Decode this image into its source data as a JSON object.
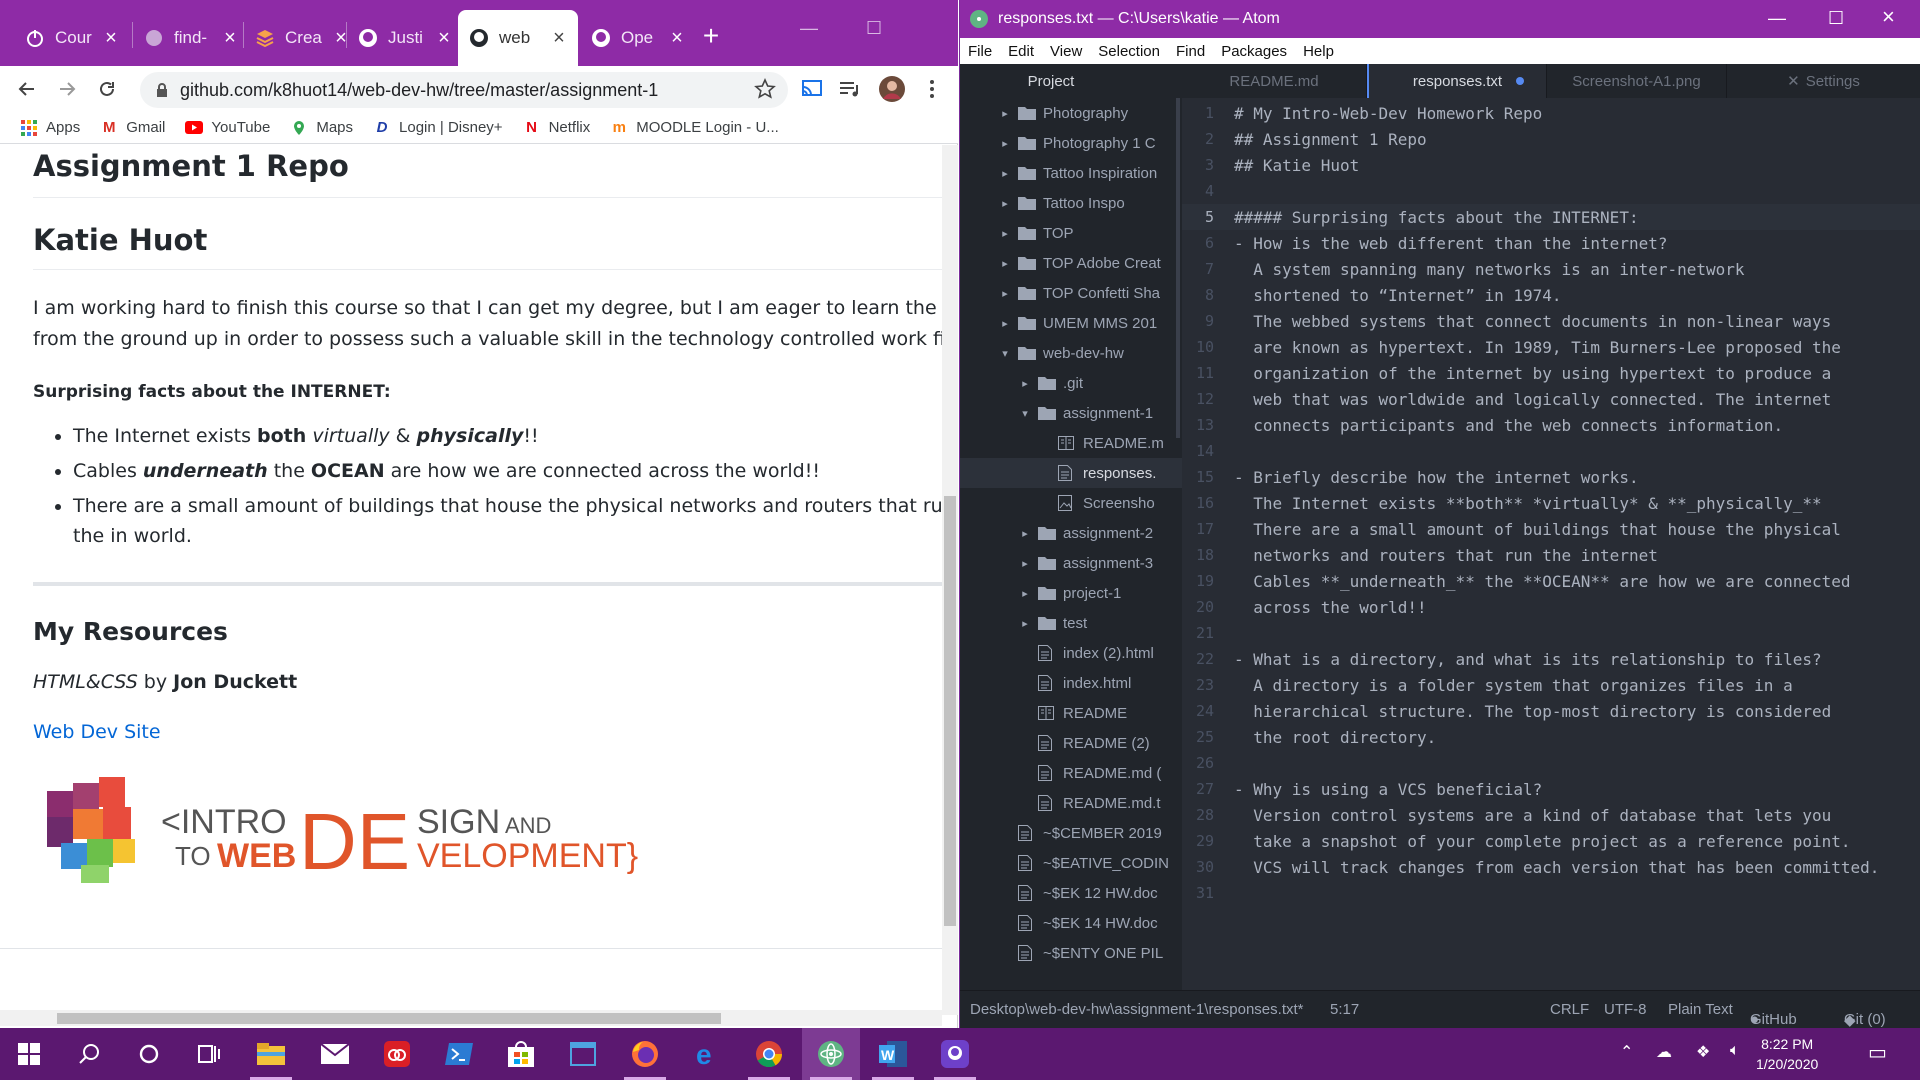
{
  "chrome": {
    "tabs": [
      {
        "label": "Cour",
        "icon": "power-icon"
      },
      {
        "label": "find-",
        "icon": "globe-icon"
      },
      {
        "label": "Crea",
        "icon": "layers-icon"
      },
      {
        "label": "Justi",
        "icon": "github-icon"
      },
      {
        "label": "web",
        "icon": "github-icon"
      },
      {
        "label": "Ope",
        "icon": "github-icon"
      }
    ],
    "new_tab_label": "+",
    "url": "github.com/k8huot14/web-dev-hw/tree/master/assignment-1",
    "bookmarks": [
      {
        "label": "Apps",
        "icon": "apps-grid-icon"
      },
      {
        "label": "Gmail",
        "icon": "gmail-icon"
      },
      {
        "label": "YouTube",
        "icon": "youtube-icon"
      },
      {
        "label": "Maps",
        "icon": "maps-icon"
      },
      {
        "label": "Login | Disney+",
        "icon": "disney-icon"
      },
      {
        "label": "Netflix",
        "icon": "netflix-icon"
      },
      {
        "label": "MOODLE Login - U...",
        "icon": "moodle-icon"
      }
    ]
  },
  "readme": {
    "h_assignment": "Assignment 1 Repo",
    "h_name": "Katie Huot",
    "intro_line1": "I am working hard to finish this course so that I can get my degree, but I am eager to learn the process",
    "intro_line2": "from the ground up in order to possess such a valuable skill in the technology controlled work field of t",
    "facts_heading": "Surprising facts about the INTERNET:",
    "fact1": {
      "a": "The Internet exists ",
      "b": "both",
      "c": " ",
      "d": "virtually",
      "e": " & ",
      "f": "physically",
      "g": "!!"
    },
    "fact2": {
      "a": "Cables ",
      "b": "underneath",
      "c": " the ",
      "d": "OCEAN",
      "e": " are how we are connected across the world!!"
    },
    "fact3": "There are a small amount of buildings that house the physical networks and routers that run the in world.",
    "resources_heading": "My Resources",
    "book_title": "HTML&CSS",
    "book_by": " by ",
    "book_author": "Jon Duckett",
    "link_label": "Web Dev Site",
    "logo": {
      "line1a": "<INTRO",
      "line1b": "TO WEB",
      "big": "DE",
      "sign": "SIGN AND",
      "velop": "VELOPMENT}"
    }
  },
  "atom": {
    "title": "responses.txt — C:\\Users\\katie — Atom",
    "menu": [
      "File",
      "Edit",
      "View",
      "Selection",
      "Find",
      "Packages",
      "Help"
    ],
    "project_label": "Project",
    "tabs": [
      "README.md",
      "responses.txt",
      "Screenshot-A1.png",
      "Settings"
    ],
    "tree": [
      {
        "label": "Photography",
        "type": "folder",
        "depth": 0,
        "open": false
      },
      {
        "label": "Photography 1 C",
        "type": "folder",
        "depth": 0,
        "open": false
      },
      {
        "label": "Tattoo Inspiration",
        "type": "folder",
        "depth": 0,
        "open": false
      },
      {
        "label": "Tattoo Inspo",
        "type": "folder",
        "depth": 0,
        "open": false
      },
      {
        "label": "TOP",
        "type": "folder",
        "depth": 0,
        "open": false
      },
      {
        "label": "TOP Adobe Creat",
        "type": "folder",
        "depth": 0,
        "open": false
      },
      {
        "label": "TOP Confetti Sha",
        "type": "folder",
        "depth": 0,
        "open": false
      },
      {
        "label": "UMEM MMS 201",
        "type": "folder",
        "depth": 0,
        "open": false
      },
      {
        "label": "web-dev-hw",
        "type": "folder",
        "depth": 0,
        "open": true
      },
      {
        "label": ".git",
        "type": "folder",
        "depth": 1,
        "open": false
      },
      {
        "label": "assignment-1",
        "type": "folder",
        "depth": 1,
        "open": true
      },
      {
        "label": "README.m",
        "type": "book",
        "depth": 2
      },
      {
        "label": "responses.",
        "type": "file",
        "depth": 2,
        "selected": true
      },
      {
        "label": "Screensho",
        "type": "image",
        "depth": 2
      },
      {
        "label": "assignment-2",
        "type": "folder",
        "depth": 1,
        "open": false
      },
      {
        "label": "assignment-3",
        "type": "folder",
        "depth": 1,
        "open": false
      },
      {
        "label": "project-1",
        "type": "folder",
        "depth": 1,
        "open": false
      },
      {
        "label": "test",
        "type": "folder",
        "depth": 1,
        "open": false
      },
      {
        "label": "index (2).html",
        "type": "file",
        "depth": 1
      },
      {
        "label": "index.html",
        "type": "file",
        "depth": 1
      },
      {
        "label": "README",
        "type": "book",
        "depth": 1
      },
      {
        "label": "README (2)",
        "type": "file",
        "depth": 1
      },
      {
        "label": "README.md (",
        "type": "file",
        "depth": 1
      },
      {
        "label": "README.md.t",
        "type": "file",
        "depth": 1
      },
      {
        "label": "~$CEMBER 2019",
        "type": "file",
        "depth": 0
      },
      {
        "label": "~$EATIVE_CODIN",
        "type": "file",
        "depth": 0
      },
      {
        "label": "~$EK 12 HW.doc",
        "type": "file",
        "depth": 0
      },
      {
        "label": "~$EK 14 HW.doc",
        "type": "file",
        "depth": 0
      },
      {
        "label": "~$ENTY ONE PIL",
        "type": "file",
        "depth": 0
      }
    ],
    "lines": [
      "# My Intro-Web-Dev Homework Repo",
      "## Assignment 1 Repo",
      "## Katie Huot",
      "",
      "##### Surprising facts about the INTERNET:",
      "- How is the web different than the internet?",
      "  A system spanning many networks is an inter-network",
      "  shortened to “Internet” in 1974.",
      "  The webbed systems that connect documents in non-linear ways",
      "  are known as hypertext. In 1989, Tim Burners-Lee proposed the",
      "  organization of the internet by using hypertext to produce a",
      "  web that was worldwide and logically connected. The internet",
      "  connects participants and the web connects information.",
      "",
      "- Briefly describe how the internet works.",
      "  The Internet exists **both** *virtually* & **_physically_**",
      "  There are a small amount of buildings that house the physical",
      "  networks and routers that run the internet",
      "  Cables **_underneath_** the **OCEAN** are how we are connected",
      "  across the world!!",
      "",
      "- What is a directory, and what is its relationship to files?",
      "  A directory is a folder system that organizes files in a",
      "  hierarchical structure. The top-most directory is considered",
      "  the root directory.",
      "",
      "- Why is using a VCS beneficial?",
      "  Version control systems are a kind of database that lets you",
      "  take a snapshot of your complete project as a reference point.",
      "  VCS will track changes from each version that has been committed.",
      ""
    ],
    "line_numbers": [
      "1",
      "2",
      "3",
      "4",
      "5",
      "6",
      "7",
      "8",
      "9",
      "10",
      "11",
      "12",
      "13",
      "14",
      "15",
      "16",
      "17",
      "18",
      "19",
      "20",
      "21",
      "22",
      "23",
      "24",
      "25",
      "26",
      "27",
      "28",
      "29",
      "30",
      "31"
    ],
    "cursor_line": 5,
    "status": {
      "path": "Desktop\\web-dev-hw\\assignment-1\\responses.txt*",
      "position": "5:17",
      "eol": "CRLF",
      "encoding": "UTF-8",
      "grammar": "Plain Text",
      "github": "GitHub",
      "git": "Git (0)"
    }
  },
  "taskbar": {
    "time": "8:22 PM",
    "date": "1/20/2020",
    "apps": [
      "start-icon",
      "search-icon",
      "cortana-icon",
      "task-view-icon",
      "file-explorer-icon",
      "mail-icon",
      "creative-cloud-icon",
      "powershell-icon",
      "store-icon",
      "window-app-icon",
      "firefox-icon",
      "edge-icon",
      "chrome-icon",
      "atom-icon",
      "word-icon",
      "github-desktop-icon"
    ]
  },
  "colors": {
    "accent": "#8e2ba6",
    "taskbar": "#5b1870",
    "atom_bg": "#282c34",
    "link": "#0366d6"
  }
}
